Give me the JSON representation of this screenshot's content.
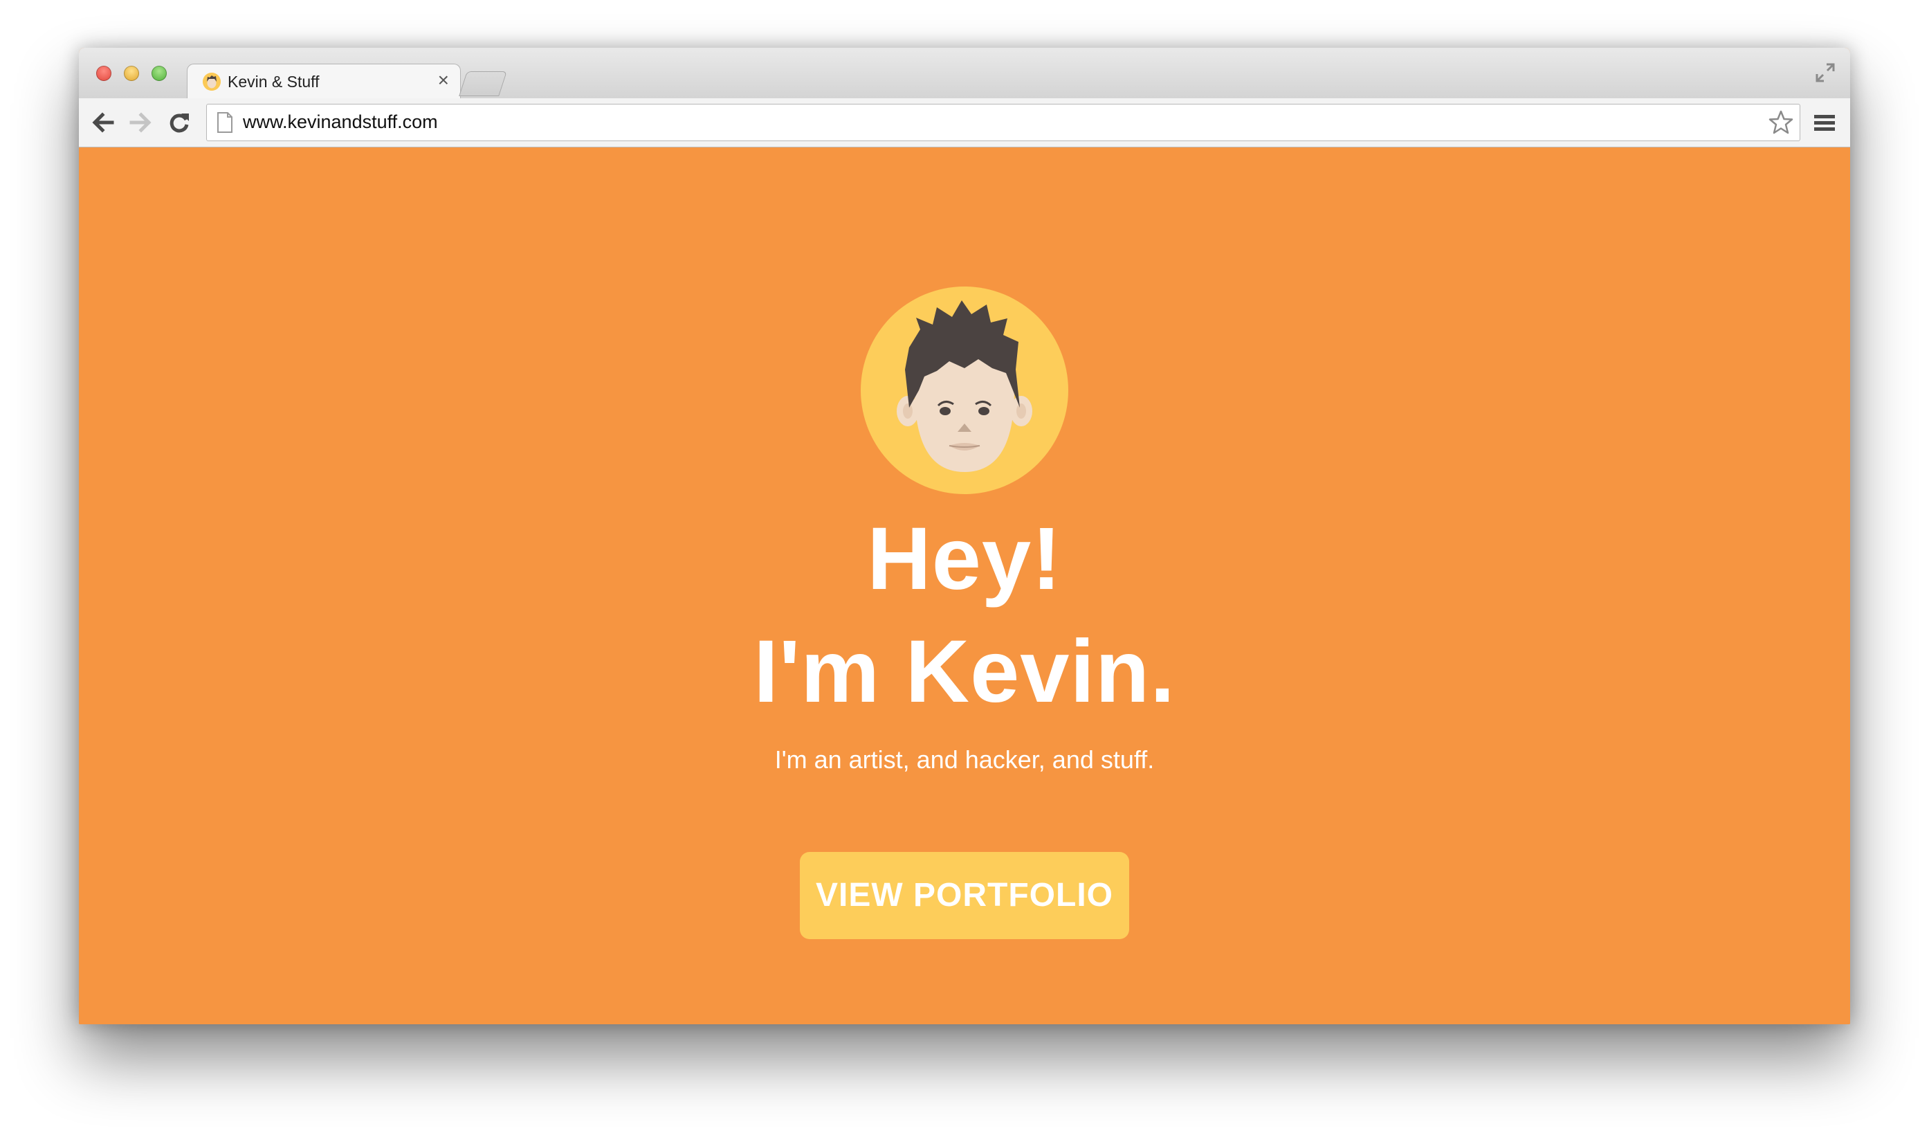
{
  "browser": {
    "tab": {
      "title": "Kevin & Stuff",
      "close_glyph": "×"
    },
    "address_bar": {
      "url": "www.kevinandstuff.com"
    },
    "icons": {
      "back": "back-arrow-icon",
      "forward": "forward-arrow-icon",
      "reload": "reload-icon",
      "page": "page-icon",
      "bookmark": "star-icon",
      "menu": "hamburger-menu-icon",
      "fullscreen": "fullscreen-icon"
    }
  },
  "hero": {
    "headline_line1": "Hey!",
    "headline_line2": "I'm Kevin.",
    "tagline": "I'm an artist, and hacker, and stuff.",
    "cta_label": "VIEW PORTFOLIO"
  },
  "colors": {
    "background": "#f69541",
    "accent": "#fdcd5a",
    "text": "#ffffff",
    "hair": "#4b4341",
    "skin": "#f1dcc8"
  }
}
